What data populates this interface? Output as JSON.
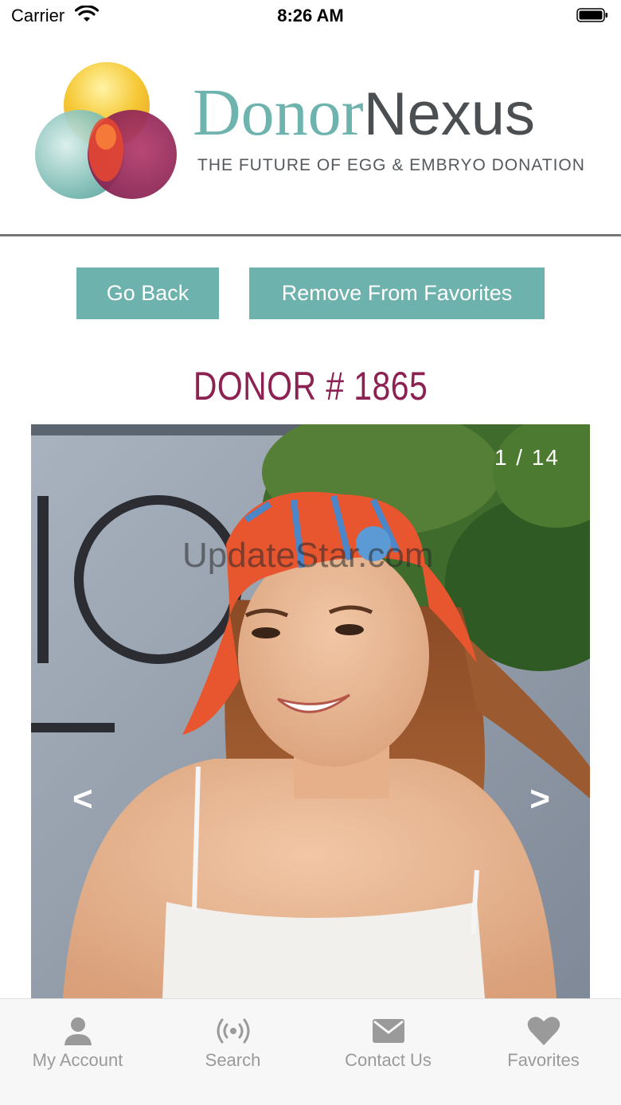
{
  "status_bar": {
    "carrier": "Carrier",
    "time": "8:26 AM"
  },
  "brand": {
    "name_part1": "Donor",
    "name_part2": "Nexus",
    "tagline": "THE FUTURE OF EGG & EMBRYO DONATION",
    "colors": {
      "teal": "#6fb3ae",
      "gray": "#4b4f52",
      "plum": "#8b2252"
    }
  },
  "actions": {
    "go_back": "Go Back",
    "remove_favorite": "Remove From Favorites"
  },
  "donor": {
    "title": "DONOR # 1865"
  },
  "gallery": {
    "counter": "1 / 14",
    "prev": "<",
    "next": ">",
    "watermark": "UpdateStar.com"
  },
  "tabs": [
    {
      "label": "My Account",
      "icon": "person-icon"
    },
    {
      "label": "Search",
      "icon": "broadcast-icon"
    },
    {
      "label": "Contact Us",
      "icon": "envelope-icon"
    },
    {
      "label": "Favorites",
      "icon": "heart-icon"
    }
  ]
}
